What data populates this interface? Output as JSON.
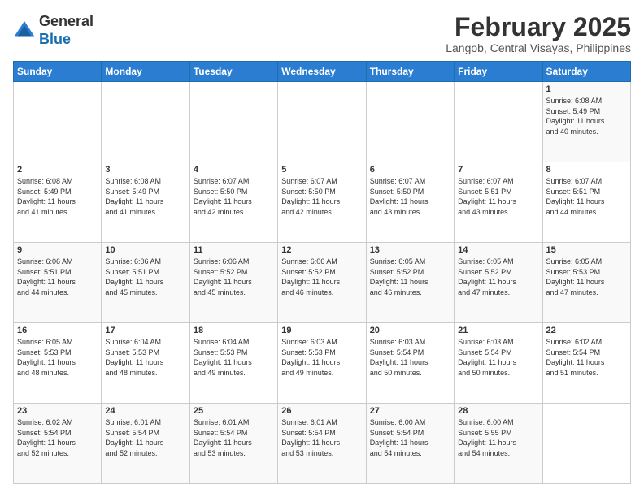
{
  "header": {
    "logo": {
      "line1": "General",
      "line2": "Blue"
    },
    "title": "February 2025",
    "location": "Langob, Central Visayas, Philippines"
  },
  "weekdays": [
    "Sunday",
    "Monday",
    "Tuesday",
    "Wednesday",
    "Thursday",
    "Friday",
    "Saturday"
  ],
  "weeks": [
    [
      {
        "day": null,
        "info": null
      },
      {
        "day": null,
        "info": null
      },
      {
        "day": null,
        "info": null
      },
      {
        "day": null,
        "info": null
      },
      {
        "day": null,
        "info": null
      },
      {
        "day": null,
        "info": null
      },
      {
        "day": "1",
        "info": "Sunrise: 6:08 AM\nSunset: 5:49 PM\nDaylight: 11 hours\nand 40 minutes."
      }
    ],
    [
      {
        "day": "2",
        "info": "Sunrise: 6:08 AM\nSunset: 5:49 PM\nDaylight: 11 hours\nand 41 minutes."
      },
      {
        "day": "3",
        "info": "Sunrise: 6:08 AM\nSunset: 5:49 PM\nDaylight: 11 hours\nand 41 minutes."
      },
      {
        "day": "4",
        "info": "Sunrise: 6:07 AM\nSunset: 5:50 PM\nDaylight: 11 hours\nand 42 minutes."
      },
      {
        "day": "5",
        "info": "Sunrise: 6:07 AM\nSunset: 5:50 PM\nDaylight: 11 hours\nand 42 minutes."
      },
      {
        "day": "6",
        "info": "Sunrise: 6:07 AM\nSunset: 5:50 PM\nDaylight: 11 hours\nand 43 minutes."
      },
      {
        "day": "7",
        "info": "Sunrise: 6:07 AM\nSunset: 5:51 PM\nDaylight: 11 hours\nand 43 minutes."
      },
      {
        "day": "8",
        "info": "Sunrise: 6:07 AM\nSunset: 5:51 PM\nDaylight: 11 hours\nand 44 minutes."
      }
    ],
    [
      {
        "day": "9",
        "info": "Sunrise: 6:06 AM\nSunset: 5:51 PM\nDaylight: 11 hours\nand 44 minutes."
      },
      {
        "day": "10",
        "info": "Sunrise: 6:06 AM\nSunset: 5:51 PM\nDaylight: 11 hours\nand 45 minutes."
      },
      {
        "day": "11",
        "info": "Sunrise: 6:06 AM\nSunset: 5:52 PM\nDaylight: 11 hours\nand 45 minutes."
      },
      {
        "day": "12",
        "info": "Sunrise: 6:06 AM\nSunset: 5:52 PM\nDaylight: 11 hours\nand 46 minutes."
      },
      {
        "day": "13",
        "info": "Sunrise: 6:05 AM\nSunset: 5:52 PM\nDaylight: 11 hours\nand 46 minutes."
      },
      {
        "day": "14",
        "info": "Sunrise: 6:05 AM\nSunset: 5:52 PM\nDaylight: 11 hours\nand 47 minutes."
      },
      {
        "day": "15",
        "info": "Sunrise: 6:05 AM\nSunset: 5:53 PM\nDaylight: 11 hours\nand 47 minutes."
      }
    ],
    [
      {
        "day": "16",
        "info": "Sunrise: 6:05 AM\nSunset: 5:53 PM\nDaylight: 11 hours\nand 48 minutes."
      },
      {
        "day": "17",
        "info": "Sunrise: 6:04 AM\nSunset: 5:53 PM\nDaylight: 11 hours\nand 48 minutes."
      },
      {
        "day": "18",
        "info": "Sunrise: 6:04 AM\nSunset: 5:53 PM\nDaylight: 11 hours\nand 49 minutes."
      },
      {
        "day": "19",
        "info": "Sunrise: 6:03 AM\nSunset: 5:53 PM\nDaylight: 11 hours\nand 49 minutes."
      },
      {
        "day": "20",
        "info": "Sunrise: 6:03 AM\nSunset: 5:54 PM\nDaylight: 11 hours\nand 50 minutes."
      },
      {
        "day": "21",
        "info": "Sunrise: 6:03 AM\nSunset: 5:54 PM\nDaylight: 11 hours\nand 50 minutes."
      },
      {
        "day": "22",
        "info": "Sunrise: 6:02 AM\nSunset: 5:54 PM\nDaylight: 11 hours\nand 51 minutes."
      }
    ],
    [
      {
        "day": "23",
        "info": "Sunrise: 6:02 AM\nSunset: 5:54 PM\nDaylight: 11 hours\nand 52 minutes."
      },
      {
        "day": "24",
        "info": "Sunrise: 6:01 AM\nSunset: 5:54 PM\nDaylight: 11 hours\nand 52 minutes."
      },
      {
        "day": "25",
        "info": "Sunrise: 6:01 AM\nSunset: 5:54 PM\nDaylight: 11 hours\nand 53 minutes."
      },
      {
        "day": "26",
        "info": "Sunrise: 6:01 AM\nSunset: 5:54 PM\nDaylight: 11 hours\nand 53 minutes."
      },
      {
        "day": "27",
        "info": "Sunrise: 6:00 AM\nSunset: 5:54 PM\nDaylight: 11 hours\nand 54 minutes."
      },
      {
        "day": "28",
        "info": "Sunrise: 6:00 AM\nSunset: 5:55 PM\nDaylight: 11 hours\nand 54 minutes."
      },
      {
        "day": null,
        "info": null
      }
    ]
  ]
}
